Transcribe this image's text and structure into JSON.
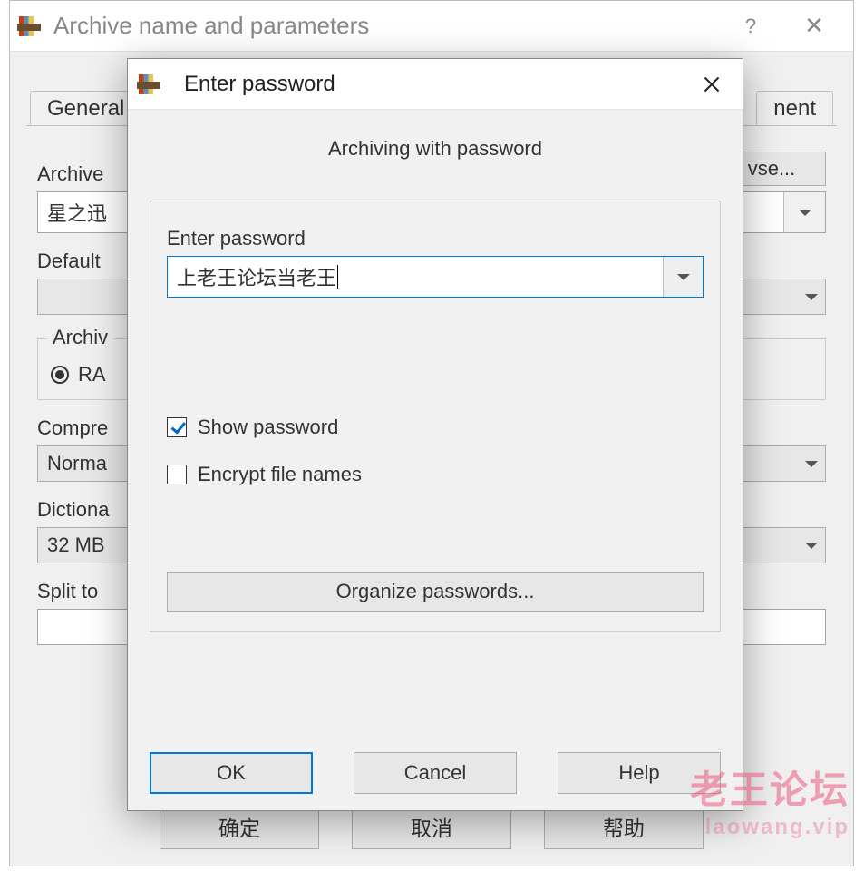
{
  "parent_dialog": {
    "title": "Archive name and parameters",
    "help_symbol": "?",
    "close_symbol": "✕",
    "tabs": {
      "first": "General",
      "last": "nent"
    },
    "archive_label": "Archive",
    "archive_value": "星之迅",
    "browse_label": "vse...",
    "default_label": "Default",
    "archive_group_label": "Archiv",
    "radio_rar": "RA",
    "compression_label": "Compre",
    "compression_value": "Norma",
    "dictionary_label": "Dictiona",
    "dictionary_value": "32 MB",
    "split_label": "Split to",
    "buttons": {
      "ok": "确定",
      "cancel": "取消",
      "help": "帮助"
    }
  },
  "pw_dialog": {
    "title": "Enter password",
    "subtitle": "Archiving with password",
    "enter_label": "Enter password",
    "password_value": "上老王论坛当老王",
    "show_password": "Show password",
    "encrypt_names": "Encrypt file names",
    "organize": "Organize passwords...",
    "ok": "OK",
    "cancel": "Cancel",
    "help": "Help"
  },
  "watermark": {
    "line1": "老王论坛",
    "line2": "laowang.vip"
  }
}
